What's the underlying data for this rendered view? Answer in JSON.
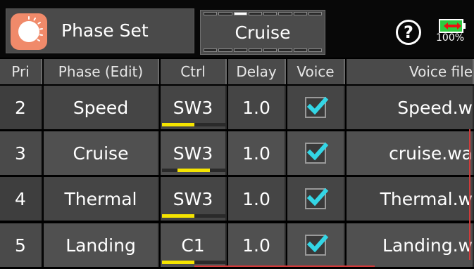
{
  "header": {
    "title": "Phase Set",
    "current_phase": "Cruise",
    "phase_segments": 8,
    "active_segment": 2,
    "help_label": "?",
    "battery_pct": "100%"
  },
  "table": {
    "columns": [
      "Pri",
      "Phase (Edit)",
      "Ctrl",
      "Delay",
      "Voice",
      "Voice file"
    ],
    "rows": [
      {
        "pri": "2",
        "phase": "Speed",
        "ctrl": "SW3",
        "delay": "1.0",
        "voice": true,
        "file": "Speed.w",
        "ctrl_level": 0.0
      },
      {
        "pri": "3",
        "phase": "Cruise",
        "ctrl": "SW3",
        "delay": "1.0",
        "voice": true,
        "file": "cruise.wa",
        "ctrl_level": 0.5
      },
      {
        "pri": "4",
        "phase": "Thermal",
        "ctrl": "SW3",
        "delay": "1.0",
        "voice": true,
        "file": "Thermal.w",
        "ctrl_level": 0.0
      },
      {
        "pri": "5",
        "phase": "Landing",
        "ctrl": "C1",
        "delay": "1.0",
        "voice": true,
        "file": "Landing.w",
        "ctrl_level": 0.0
      }
    ]
  },
  "colors": {
    "accent_check": "#33d6e6",
    "bar_fill": "#f5e400",
    "logo": "#f08a6a",
    "battery": "#2ecc40",
    "scroll_indicator": "#d23a3a"
  }
}
